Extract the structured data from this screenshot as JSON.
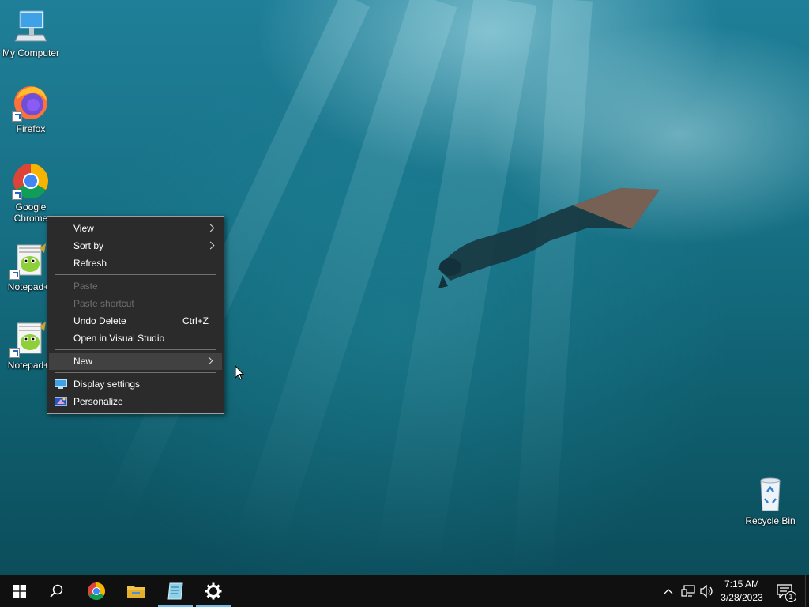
{
  "desktop": {
    "icons": [
      {
        "label": "My Computer",
        "icon": "monitor-icon"
      },
      {
        "label": "Firefox",
        "icon": "firefox-icon"
      },
      {
        "label": "Google Chrome",
        "label_line1": "Google",
        "label_line2": "Chrome",
        "icon": "chrome-icon"
      },
      {
        "label": "Notepad+",
        "icon": "notepad-plus-plus-icon"
      },
      {
        "label": "Notepad+",
        "icon": "notepad-plus-plus-icon"
      },
      {
        "label": "Recycle Bin",
        "icon": "recycle-bin-icon"
      }
    ]
  },
  "context_menu": {
    "items": [
      {
        "label": "View",
        "submenu": true
      },
      {
        "label": "Sort by",
        "submenu": true
      },
      {
        "label": "Refresh"
      },
      {
        "label": "Paste",
        "disabled": true
      },
      {
        "label": "Paste shortcut",
        "disabled": true
      },
      {
        "label": "Undo Delete",
        "shortcut": "Ctrl+Z"
      },
      {
        "label": "Open in Visual Studio"
      },
      {
        "label": "New",
        "submenu": true,
        "highlighted": true
      },
      {
        "label": "Display settings",
        "icon": "display-settings-icon"
      },
      {
        "label": "Personalize",
        "icon": "personalize-icon"
      }
    ]
  },
  "taskbar": {
    "buttons": [
      {
        "name": "start",
        "icon": "windows-logo-icon"
      },
      {
        "name": "search",
        "icon": "search-icon"
      },
      {
        "name": "chrome",
        "icon": "chrome-icon"
      },
      {
        "name": "file-explorer",
        "icon": "folder-icon"
      },
      {
        "name": "notepad",
        "icon": "notepad-icon",
        "active": true
      },
      {
        "name": "settings",
        "icon": "gear-icon",
        "active": true
      }
    ],
    "tray": {
      "time": "7:15 AM",
      "date": "3/28/2023",
      "notification_count": "1"
    }
  },
  "colors": {
    "menu_bg": "#2b2b2b",
    "menu_hover": "#414141",
    "taskbar_bg": "#101010",
    "active_indicator": "#76b9ed"
  }
}
